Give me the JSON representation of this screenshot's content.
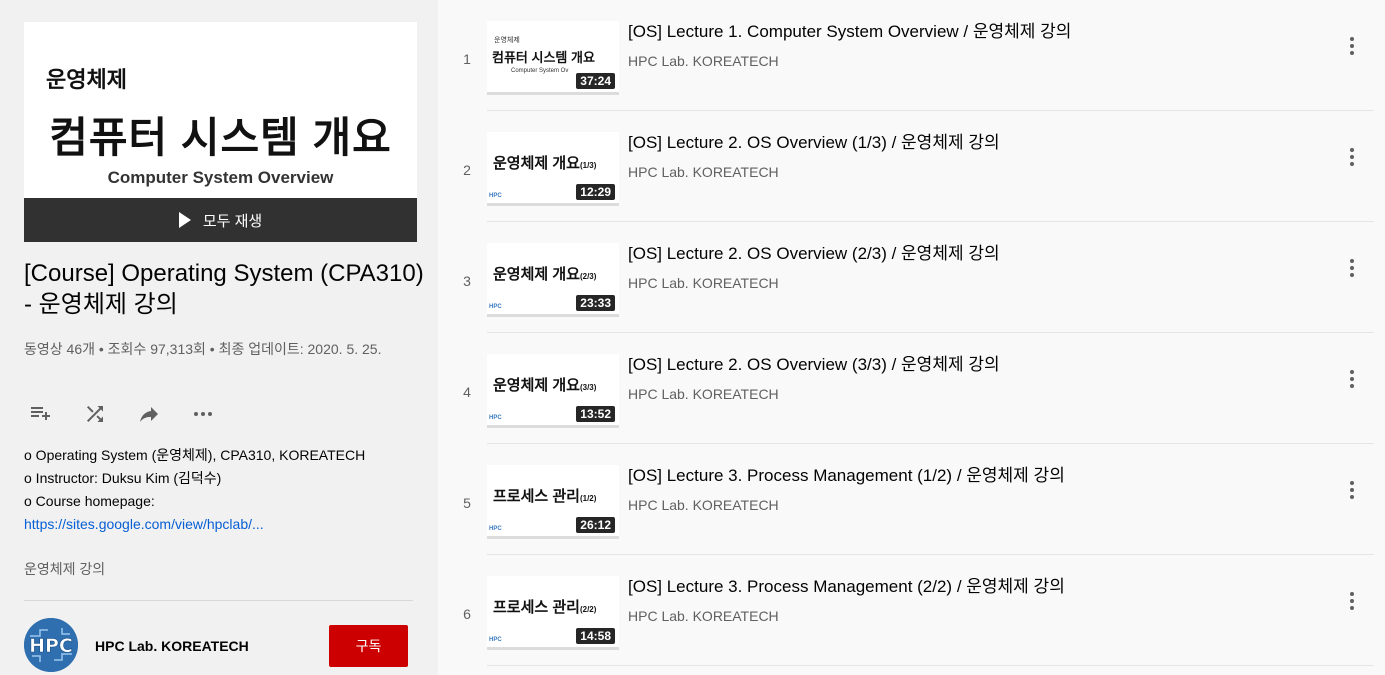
{
  "playlist": {
    "hero": {
      "line1": "운영체제",
      "line2": "컴퓨터 시스템 개요",
      "line3": "Computer System Overview",
      "play_all_label": "모두 재생"
    },
    "title": "[Course] Operating System (CPA310) - 운영체제 강의",
    "stats": "동영상 46개 • 조회수 97,313회 • 최종 업데이트: 2020. 5. 25.",
    "actions": [
      "add-to-queue-icon",
      "shuffle-icon",
      "share-icon",
      "more-horiz-icon"
    ],
    "description": {
      "line1": "o Operating System (운영체제), CPA310, KOREATECH",
      "line2": "o Instructor: Duksu Kim (김덕수)",
      "line3": "o Course homepage:",
      "link": "https://sites.google.com/view/hpclab/..."
    },
    "tag": "운영체제 강의",
    "owner": {
      "avatar_text": "HPC",
      "name": "HPC Lab. KOREATECH",
      "subscribe_label": "구독"
    }
  },
  "videos": [
    {
      "index": "1",
      "title": "[OS] Lecture 1. Computer System Overview / 운영체제 강의",
      "channel": "HPC Lab. KOREATECH",
      "duration": "37:24",
      "thumb": {
        "style": "overview",
        "small": "운영체제",
        "big": "컴퓨터 시스템 개요",
        "sub": "Computer System Ov",
        "badge": ""
      }
    },
    {
      "index": "2",
      "title": "[OS] Lecture 2. OS Overview (1/3) / 운영체제 강의",
      "channel": "HPC Lab. KOREATECH",
      "duration": "12:29",
      "thumb": {
        "style": "big",
        "big": "운영체제 개요",
        "part": "(1/3)",
        "badge": "HPC"
      }
    },
    {
      "index": "3",
      "title": "[OS] Lecture 2. OS Overview (2/3) / 운영체제 강의",
      "channel": "HPC Lab. KOREATECH",
      "duration": "23:33",
      "thumb": {
        "style": "big",
        "big": "운영체제 개요",
        "part": "(2/3)",
        "badge": "HPC"
      }
    },
    {
      "index": "4",
      "title": "[OS] Lecture 2. OS Overview (3/3) / 운영체제 강의",
      "channel": "HPC Lab. KOREATECH",
      "duration": "13:52",
      "thumb": {
        "style": "big",
        "big": "운영체제 개요",
        "part": "(3/3)",
        "badge": "HPC"
      }
    },
    {
      "index": "5",
      "title": "[OS] Lecture 3. Process Management (1/2) / 운영체제 강의",
      "channel": "HPC Lab. KOREATECH",
      "duration": "26:12",
      "thumb": {
        "style": "big",
        "big": "프로세스 관리",
        "part": "(1/2)",
        "badge": "HPC"
      }
    },
    {
      "index": "6",
      "title": "[OS] Lecture 3. Process Management (2/2) / 운영체제 강의",
      "channel": "HPC Lab. KOREATECH",
      "duration": "14:58",
      "thumb": {
        "style": "big",
        "big": "프로세스 관리",
        "part": "(2/2)",
        "badge": "HPC"
      }
    }
  ],
  "colors": {
    "subscribe": "#cc0000",
    "link": "#065fd4",
    "sidebar_bg": "#f1f1f1",
    "page_bg": "#f9f9f9"
  }
}
